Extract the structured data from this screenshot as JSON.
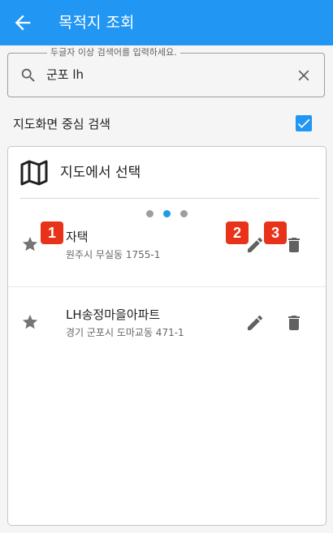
{
  "appbar": {
    "back_icon": "arrow-back-icon",
    "title": "목적지 조회",
    "color": "#2196f3"
  },
  "search": {
    "legend": "두글자 이상 검색어를 입력하세요.",
    "value": "군포 lh",
    "search_icon": "search-icon",
    "clear_icon": "close-icon"
  },
  "center_search": {
    "label": "지도화면 중심 검색",
    "checked": true
  },
  "card": {
    "title": "지도에서 선택",
    "icon": "map-icon",
    "pager": {
      "count": 3,
      "active_index": 1
    },
    "items": [
      {
        "name": "자택",
        "address": "원주시 무실동 1755-1"
      },
      {
        "name": "LH송정마을아파트",
        "address": "경기 군포시 도마교동 471-1"
      }
    ]
  },
  "badges": [
    "1",
    "2",
    "3"
  ]
}
